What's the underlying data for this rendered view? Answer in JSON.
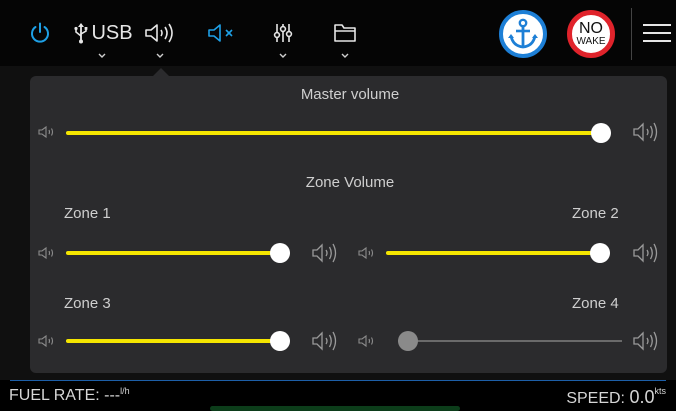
{
  "topbar": {
    "usb_label": "USB",
    "anchor_icon": "anchor-icon",
    "no_wake": {
      "line1": "NO",
      "line2": "WAKE"
    }
  },
  "panel": {
    "master": {
      "title": "Master volume",
      "level": 100
    },
    "zone_title": "Zone Volume",
    "zones": [
      {
        "label": "Zone 1",
        "level": 100,
        "enabled": true
      },
      {
        "label": "Zone 2",
        "level": 100,
        "enabled": true
      },
      {
        "label": "Zone 3",
        "level": 100,
        "enabled": true
      },
      {
        "label": "Zone 4",
        "level": 0,
        "enabled": false
      }
    ]
  },
  "status": {
    "fuel_label": "FUEL RATE:",
    "fuel_value": "---",
    "fuel_unit": "l/h",
    "speed_label": "SPEED:",
    "speed_value": "0.0",
    "speed_unit": "kts"
  },
  "colors": {
    "accent": "#1ea0e6",
    "slider_fill": "#f5e600",
    "anchor_ring": "#1d7fd6",
    "nowake_ring": "#e0232b"
  }
}
